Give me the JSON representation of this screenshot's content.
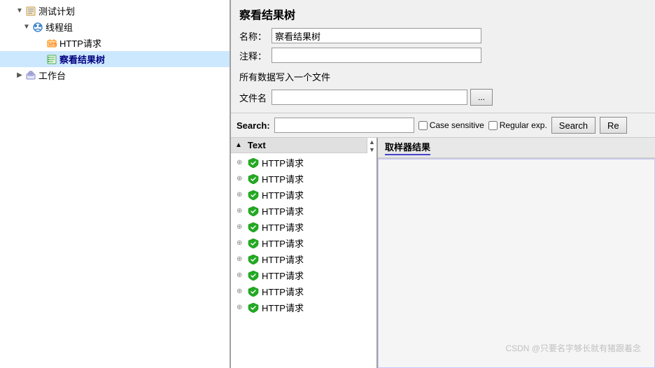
{
  "app": {
    "title": "察看结果树"
  },
  "left_tree": {
    "items": [
      {
        "id": "plan",
        "label": "测试计划",
        "level": 0,
        "expanded": true,
        "type": "plan"
      },
      {
        "id": "thread-group",
        "label": "线程组",
        "level": 1,
        "expanded": true,
        "type": "thread-group"
      },
      {
        "id": "http-request",
        "label": "HTTP请求",
        "level": 2,
        "expanded": false,
        "type": "http"
      },
      {
        "id": "result-tree",
        "label": "察看结果树",
        "level": 2,
        "expanded": false,
        "type": "result-tree",
        "selected": true
      },
      {
        "id": "workbench",
        "label": "工作台",
        "level": 0,
        "expanded": false,
        "type": "workbench"
      }
    ]
  },
  "right_panel": {
    "title": "察看结果树",
    "name_label": "名称：",
    "name_value": "察看结果树",
    "comment_label": "注释：",
    "comment_value": "",
    "all_data_text": "所有数据写入一个文件",
    "filename_label": "文件名",
    "filename_value": ""
  },
  "search_bar": {
    "label": "Search:",
    "input_value": "",
    "case_sensitive_label": "Case sensitive",
    "regular_exp_label": "Regular exp.",
    "search_button": "Search",
    "reset_button": "Re"
  },
  "results_panel": {
    "column_label": "Text",
    "tab_label": "取样器结果",
    "items": [
      {
        "label": "HTTP请求"
      },
      {
        "label": "HTTP请求"
      },
      {
        "label": "HTTP请求"
      },
      {
        "label": "HTTP请求"
      },
      {
        "label": "HTTP请求"
      },
      {
        "label": "HTTP请求"
      },
      {
        "label": "HTTP请求"
      },
      {
        "label": "HTTP请求"
      },
      {
        "label": "HTTP请求"
      },
      {
        "label": "HTTP请求"
      }
    ]
  },
  "watermark": "CSDN @只要名字够长就有猪跟着念"
}
